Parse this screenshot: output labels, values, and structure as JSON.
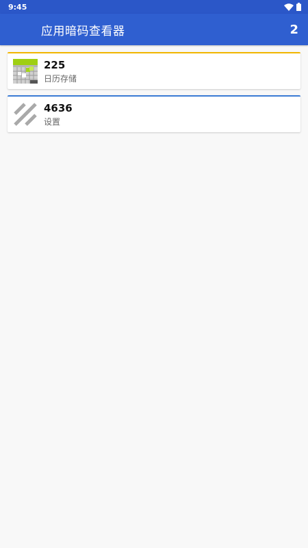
{
  "status_bar": {
    "time": "9:45",
    "icons": [
      "wifi-icon",
      "battery-icon"
    ]
  },
  "app_bar": {
    "title": "应用暗码查看器",
    "count": "2"
  },
  "items": [
    {
      "code": "225",
      "name": "日历存储",
      "icon": "calendar-storage-icon",
      "accent_color": "#f2b600"
    },
    {
      "code": "4636",
      "name": "设置",
      "icon": "settings-striped-icon",
      "accent_color": "#3a7bd5"
    }
  ],
  "colors": {
    "status_bar": "#2b57c8",
    "app_bar": "#2f5fd0",
    "background": "#f8f8f8"
  }
}
